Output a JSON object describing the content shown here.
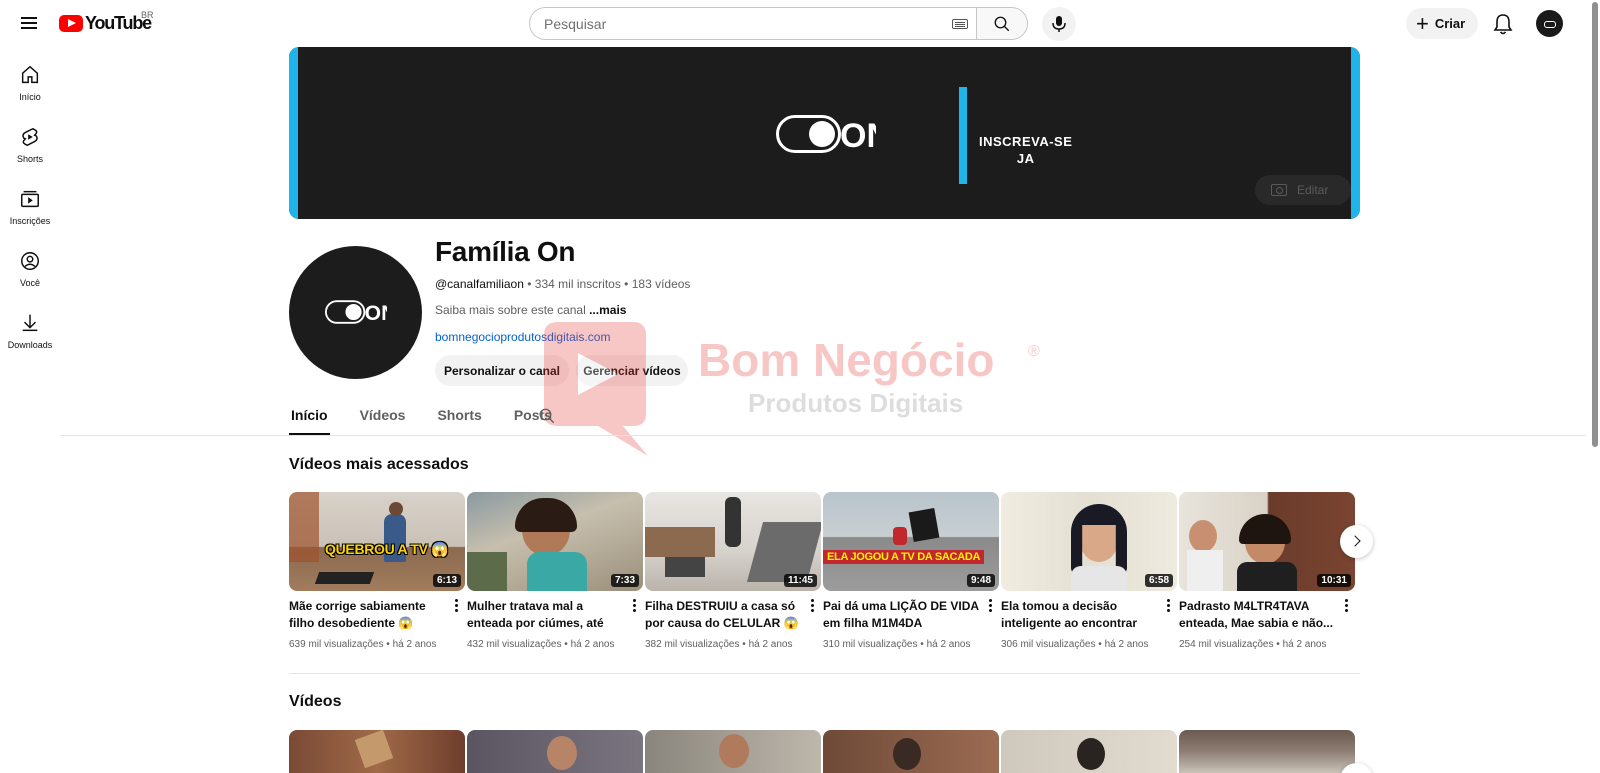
{
  "header": {
    "logo_text": "YouTube",
    "country_code": "BR",
    "search_placeholder": "Pesquisar",
    "create_label": "Criar"
  },
  "sidebar": {
    "items": [
      {
        "label": "Início",
        "icon": "home-icon"
      },
      {
        "label": "Shorts",
        "icon": "shorts-icon"
      },
      {
        "label": "Inscrições",
        "icon": "subscriptions-icon"
      },
      {
        "label": "Você",
        "icon": "you-icon"
      },
      {
        "label": "Downloads",
        "icon": "download-icon"
      }
    ]
  },
  "banner": {
    "logo_text": "ON",
    "cta_line1": "INSCREVA-SE",
    "cta_line2": "JA",
    "edit_label": "Editar",
    "accent_color": "#20b5ea"
  },
  "channel": {
    "name": "Família On",
    "handle": "@canalfamiliaon",
    "subscribers": "334 mil inscritos",
    "videos_count": "183 vídeos",
    "separator": "•",
    "description": "Saiba mais sobre este canal",
    "more_label": "...mais",
    "link": "bomnegocioprodutosdigitais.com",
    "customize_label": "Personalizar o canal",
    "manage_label": "Gerenciar vídeos"
  },
  "watermark": {
    "line1": "Bom Negócio",
    "line2": "Produtos Digitais",
    "registered": "®"
  },
  "tabs": [
    {
      "label": "Início",
      "active": true
    },
    {
      "label": "Vídeos",
      "active": false
    },
    {
      "label": "Shorts",
      "active": false
    },
    {
      "label": "Posts",
      "active": false
    }
  ],
  "sections": {
    "popular_title": "Vídeos mais acessados",
    "videos_title": "Vídeos"
  },
  "popular_videos": [
    {
      "title": "Mãe corrige sabiamente filho desobediente 😱",
      "views": "639 mil visualizações",
      "age": "há 2 anos",
      "duration": "6:13",
      "overlay": "QUEBROU A TV 😱"
    },
    {
      "title": "Mulher tratava mal a enteada por ciúmes, até que isso...",
      "views": "432 mil visualizações",
      "age": "há 2 anos",
      "duration": "7:33",
      "overlay": ""
    },
    {
      "title": "Filha DESTRUIU a casa só por causa do CELULAR 😱",
      "views": "382 mil visualizações",
      "age": "há 2 anos",
      "duration": "11:45",
      "overlay": ""
    },
    {
      "title": "Pai dá uma LIÇÃO DE VIDA em filha M1M4DA",
      "views": "310 mil visualizações",
      "age": "há 2 anos",
      "duration": "9:48",
      "overlay": "ELA JOGOU A TV DA SACADA"
    },
    {
      "title": "Ela tomou a decisão inteligente ao encontrar seu...",
      "views": "306 mil visualizações",
      "age": "há 2 anos",
      "duration": "6:58",
      "overlay": ""
    },
    {
      "title": "Padrasto M4LTR4TAVA enteada, Mae sabia e não...",
      "views": "254 mil visualizações",
      "age": "há 2 anos",
      "duration": "10:31",
      "overlay": ""
    }
  ]
}
